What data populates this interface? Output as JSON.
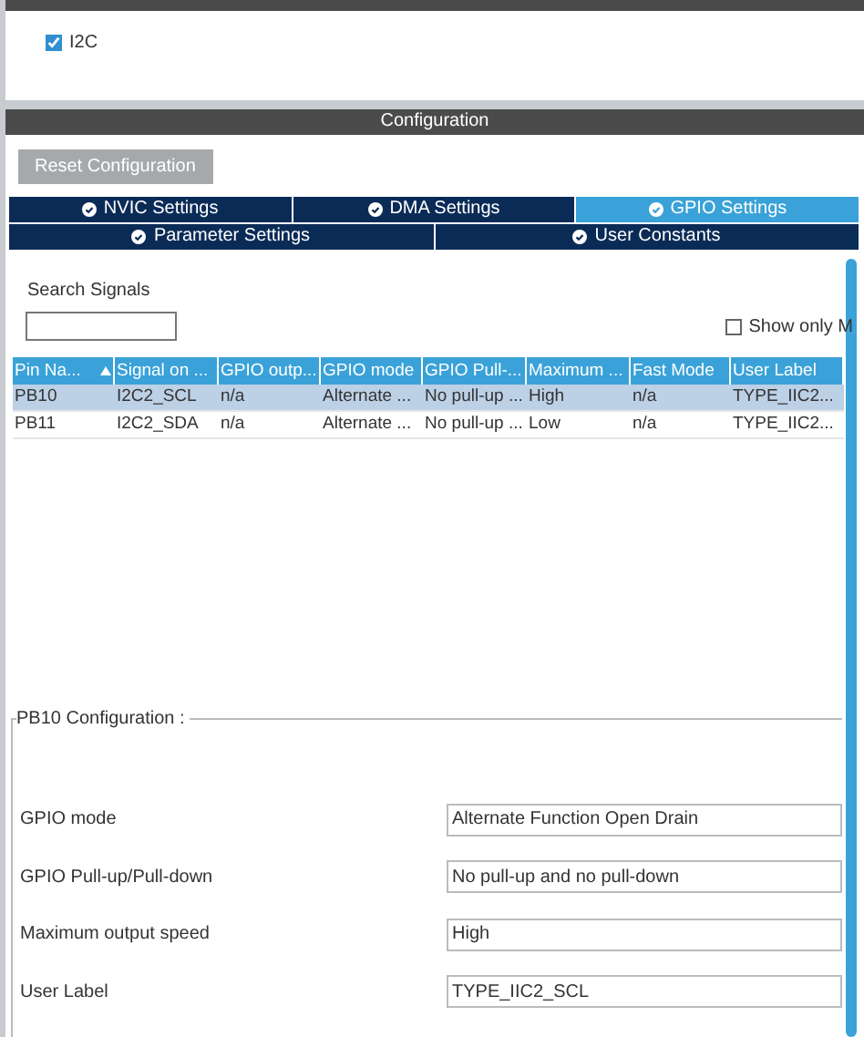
{
  "mode": {
    "options": [
      {
        "label": "I2C",
        "checked": true
      }
    ]
  },
  "configuration": {
    "title": "Configuration",
    "reset_button": "Reset Configuration",
    "tabs": [
      [
        {
          "label": "NVIC Settings",
          "selected": false
        },
        {
          "label": "DMA Settings",
          "selected": false
        },
        {
          "label": "GPIO Settings",
          "selected": true
        }
      ],
      [
        {
          "label": "Parameter Settings",
          "selected": false
        },
        {
          "label": "User Constants",
          "selected": false
        }
      ]
    ],
    "search": {
      "label": "Search Signals"
    },
    "show_only": {
      "label": "Show only M",
      "checked": false
    },
    "table": {
      "columns": [
        "Pin Na...",
        "Signal on ...",
        "GPIO outp...",
        "GPIO mode",
        "GPIO Pull-...",
        "Maximum ...",
        "Fast Mode",
        "User Label"
      ],
      "rows": [
        {
          "selected": true,
          "cells": [
            "PB10",
            "I2C2_SCL",
            "n/a",
            "Alternate ...",
            "No pull-up ...",
            "High",
            "n/a",
            "TYPE_IIC2..."
          ]
        },
        {
          "selected": false,
          "cells": [
            "PB11",
            "I2C2_SDA",
            "n/a",
            "Alternate ...",
            "No pull-up ...",
            "Low",
            "n/a",
            "TYPE_IIC2..."
          ]
        }
      ]
    },
    "pin_config": {
      "title": "PB10 Configuration :",
      "fields": [
        {
          "label": "GPIO mode",
          "value": "Alternate Function Open Drain"
        },
        {
          "label": "GPIO Pull-up/Pull-down",
          "value": "No pull-up and no pull-down"
        },
        {
          "label": "Maximum output speed",
          "value": "High"
        },
        {
          "label": "User Label",
          "value": "TYPE_IIC2_SCL"
        }
      ]
    }
  }
}
